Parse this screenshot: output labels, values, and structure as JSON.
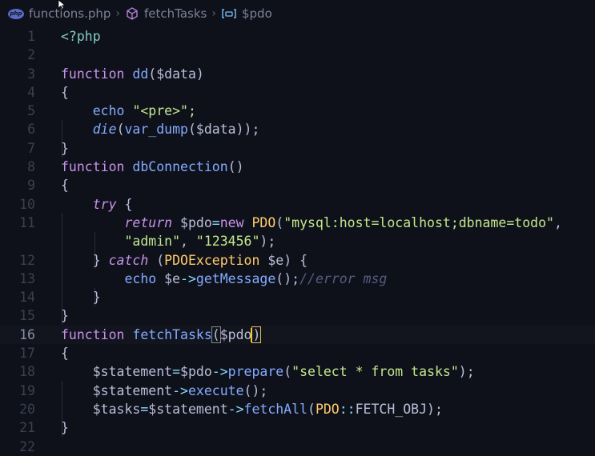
{
  "breadcrumb": {
    "file": "functions.php",
    "file_icon_text": "php",
    "symbol": "fetchTasks",
    "variable": "$pdo"
  },
  "colors": {
    "background": "#0f111a",
    "keyword": "#c792ea",
    "function": "#82aaff",
    "string": "#c3e88d",
    "class": "#ffcb6b",
    "operator": "#89ddff",
    "comment": "#545c7e",
    "line_number": "#3b3f51"
  },
  "editor": {
    "line_numbers": [
      "1",
      "2",
      "3",
      "4",
      "5",
      "6",
      "7",
      "8",
      "9",
      "10",
      "11",
      "",
      "12",
      "13",
      "14",
      "15",
      "16",
      "17",
      "18",
      "19",
      "20",
      "21",
      "22"
    ],
    "lines": {
      "l1": "<?php",
      "l3_kw": "function",
      "l3_fn": "dd",
      "l3_rest": "($data)",
      "l4": "{",
      "l5_fn": "echo",
      "l5_q1": "\"",
      "l5_str": "<pre>",
      "l5_q2": "\";",
      "l6_fn": "die",
      "l6_p1": "(",
      "l6_fn2": "var_dump",
      "l6_rest": "($data));",
      "l7": "}",
      "l8_kw": "function",
      "l8_fn": "dbConnection",
      "l8_rest": "()",
      "l9": "{",
      "l10_kw": "try",
      "l10_rest": " {",
      "l11_kw": "return",
      "l11_var": " $pdo",
      "l11_op": "=",
      "l11_new": "new",
      "l11_cls": " PDO",
      "l11_p": "(",
      "l11_str": "\"mysql:host=localhost;dbname=todo\"",
      "l11_comma": ",",
      "l11b_str1": "\"admin\"",
      "l11b_comma": ", ",
      "l11b_str2": "\"123456\"",
      "l11b_end": ");",
      "l12_b": "} ",
      "l12_kw": "catch",
      "l12_p1": " (",
      "l12_cls": "PDOException",
      "l12_var": " $e",
      "l12_rest": ") {",
      "l13_fn": "echo",
      "l13_var": " $e",
      "l13_op": "->",
      "l13_meth": "getMessage",
      "l13_rest": "();",
      "l13_cmt": "//error msg",
      "l14": "}",
      "l15": "}",
      "l16_kw": "function",
      "l16_fn": "fetchTasks",
      "l16_p1": "(",
      "l16_var": "$pdo",
      "l16_p2": ")",
      "l17": "{",
      "l18_var": "$statement",
      "l18_op": "=",
      "l18_var2": "$pdo",
      "l18_arrow": "->",
      "l18_meth": "prepare",
      "l18_p": "(",
      "l18_str": "\"select * from tasks\"",
      "l18_end": ");",
      "l19_var": "$statement",
      "l19_arrow": "->",
      "l19_meth": "execute",
      "l19_end": "();",
      "l20_var": "$tasks",
      "l20_op": "=",
      "l20_var2": "$statement",
      "l20_arrow": "->",
      "l20_meth": "fetchAll",
      "l20_p": "(",
      "l20_cls": "PDO",
      "l20_dc": "::",
      "l20_const": "FETCH_OBJ",
      "l20_end": ");",
      "l21": "}"
    }
  }
}
